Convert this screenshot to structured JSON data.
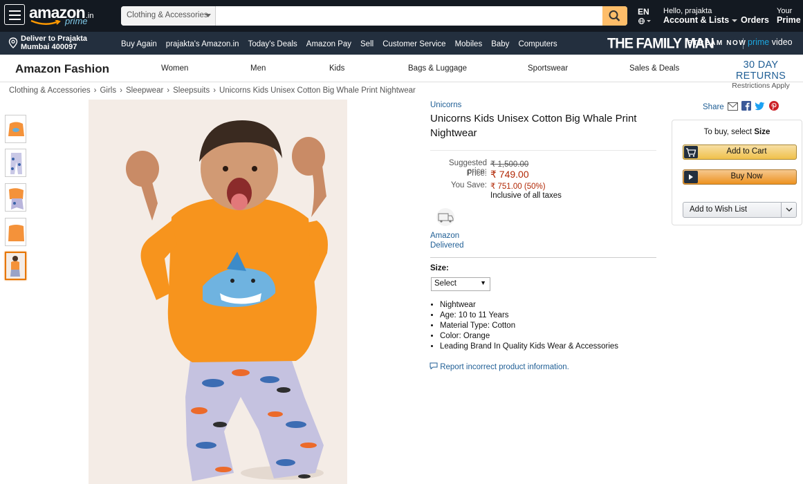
{
  "header": {
    "logo": {
      "word": "amazon",
      "tld": ".in",
      "sub": "prime"
    },
    "search": {
      "category": "Clothing & Accessories",
      "placeholder": ""
    },
    "lang": {
      "code": "EN"
    },
    "account": {
      "greeting": "Hello, prajakta",
      "label": "Account & Lists"
    },
    "orders": "Orders",
    "your_prime": {
      "l1": "Your",
      "l2": "Prime"
    }
  },
  "subnav": {
    "deliver": {
      "line1": "Deliver to Prajakta",
      "line2": "Mumbai 400097"
    },
    "links": [
      "Buy Again",
      "prajakta's Amazon.in",
      "Today's Deals",
      "Amazon Pay",
      "Sell",
      "Customer Service",
      "Mobiles",
      "Baby",
      "Computers"
    ],
    "promo": {
      "show": "THE FAMILY MAN",
      "stream": "STREAM NOW",
      "prime": "prime",
      "video": "video"
    }
  },
  "fashion": {
    "title": "Amazon Fashion",
    "categories": [
      "Women",
      "Men",
      "Kids",
      "Bags & Luggage",
      "Sportswear",
      "Sales & Deals"
    ],
    "returns": {
      "headline": "30 DAY RETURNS",
      "sub": "Restrictions Apply"
    }
  },
  "breadcrumb": [
    "Clothing & Accessories",
    "Girls",
    "Sleepwear",
    "Sleepsuits",
    "Unicorns Kids Unisex Cotton Big Whale Print Nightwear"
  ],
  "product": {
    "brand": "Unicorns",
    "title": "Unicorns Kids Unisex Cotton Big Whale Print Nightwear",
    "prices": {
      "suggested_label": "Suggested price:",
      "suggested": "₹ 1,500.00",
      "price_label": "Price:",
      "price": "₹ 749.00",
      "save_label": "You Save:",
      "save": "₹ 751.00 (50%)",
      "tax_note": "Inclusive of all taxes"
    },
    "delivered": {
      "line1": "Amazon",
      "line2": "Delivered"
    },
    "size": {
      "label": "Size:",
      "selected": "Select"
    },
    "features": [
      "Nightwear",
      "Age: 10 to 11 Years",
      "Material Type: Cotton",
      "Color: Orange",
      "Leading Brand In Quality Kids Wear & Accessories"
    ],
    "report": "Report incorrect product information."
  },
  "buybox": {
    "share": "Share",
    "tobuy_prefix": "To buy, select",
    "tobuy_bold": "Size",
    "add_to_cart": "Add to Cart",
    "buy_now": "Buy Now",
    "wish_list": "Add to Wish List"
  },
  "colors": {
    "nav": "#131921",
    "subnav": "#232f3e",
    "link": "#1f5e95",
    "price": "#b12704",
    "accent": "#febd69"
  }
}
